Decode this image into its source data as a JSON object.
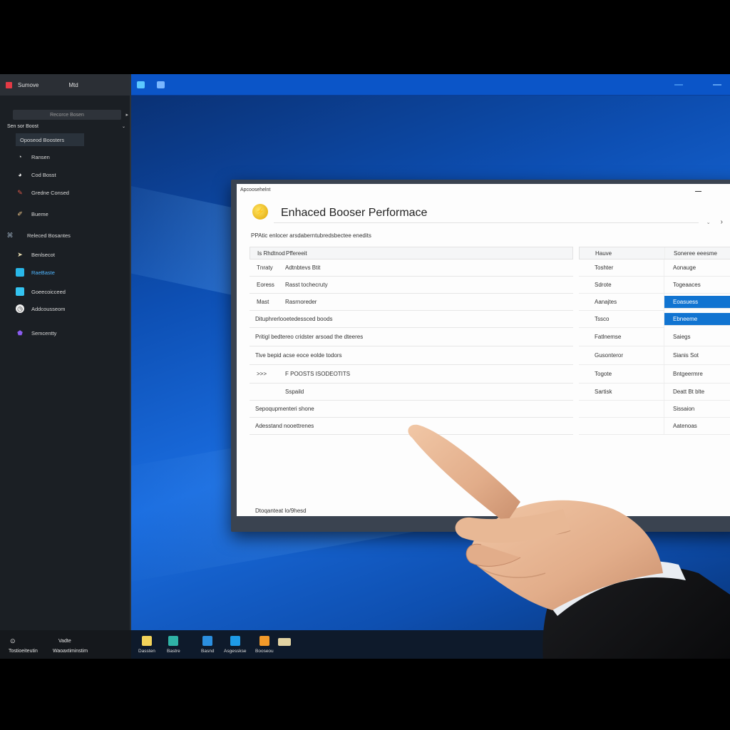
{
  "sidebar": {
    "header_left": "Sumove",
    "header_right": "Mtd",
    "search_placeholder": "Recorce Bosen",
    "group_label": "Sen sor Boost",
    "items": [
      {
        "label": "Oposeod Boosters",
        "icon": "selected-item"
      },
      {
        "label": "Ransen",
        "icon": "compass-icon"
      },
      {
        "label": "Cod Bosst",
        "icon": "speed-icon"
      },
      {
        "label": "Gredne Consed",
        "icon": "tools-icon"
      },
      {
        "label": "Bueme",
        "icon": "brush-icon"
      },
      {
        "label": "Releced Bosantes",
        "icon": "document-icon"
      },
      {
        "label": "Benlsecot",
        "icon": "tag-icon"
      },
      {
        "label": "RaeBaste",
        "icon": "image-icon"
      },
      {
        "label": "Goeecoicceed",
        "icon": "monitor-icon"
      },
      {
        "label": "Addcousseom",
        "icon": "gauge-icon"
      },
      {
        "label": "Semcentty",
        "icon": "shield-icon"
      }
    ],
    "footer": {
      "top_left": "⊙",
      "top_right": "Vadte",
      "bottom_left": "Tostioeiteutin",
      "bottom_right": "Waoaxtiminstim"
    }
  },
  "window": {
    "title_bar": "Apcoosehelnt",
    "app_title": "Enhaced Booser Performace",
    "subheading": "PPAtic enlocer  arsdaberntubredsbectee enedits",
    "left_table": {
      "header": [
        "Is Rhdtnod",
        "Pffereeit"
      ],
      "rows": [
        {
          "c1": "Tnraty",
          "c2": "Adtnbtevs Btit"
        },
        {
          "c1": "Eoress",
          "c2": "Rasst tochecruty"
        },
        {
          "c1": "Mast",
          "c2": "Rasrnoreder"
        },
        {
          "full": "Dituphrerlooetedessced boods"
        },
        {
          "full": "Pritigl bedtereo cridster arsoad the dteeres"
        },
        {
          "full": "Tive bepid acse eoce eolde todors"
        },
        {
          "c1": "&gt;&gt;&gt;",
          "c2": "F POOSTS ISODEOTITS"
        },
        {
          "c1": "",
          "c2": "Sspaild"
        },
        {
          "full": "Sepoqupmenteri shone"
        },
        {
          "full": "Adesstand nooettrenes"
        }
      ]
    },
    "right_table": {
      "header": [
        "Hauve",
        "Soneree eeesme"
      ],
      "rows": [
        {
          "a": "Toshter",
          "b": "Aonauge"
        },
        {
          "a": "Sdrote",
          "b": "Togeaaces"
        },
        {
          "a": "Aanajtes",
          "b": "Eoasuess",
          "b_selected": true
        },
        {
          "a": "Tssco",
          "b": "Ebneeme",
          "b_selected": true
        },
        {
          "a": "Fatlnemse",
          "b": "Saiegs"
        },
        {
          "a": "Gusonteror",
          "b": "Sianis Sot"
        },
        {
          "a": "Togote",
          "b": "Bntgeermre"
        },
        {
          "a": "Sartisk",
          "b": "Deatt Bt blte"
        },
        {
          "a": "",
          "b": "Sissaion"
        },
        {
          "a": "",
          "b": "Aatenoas"
        }
      ]
    },
    "footnote": "Dtoqanteat lo/9hesd"
  },
  "taskbar": {
    "items": [
      {
        "label": "Dassten",
        "color": "#f3d35a"
      },
      {
        "label": "Bastre",
        "color": "#2fb3a6"
      },
      {
        "label": "Basnd",
        "color": "#2b8fe0"
      },
      {
        "label": "Asgesskse",
        "color": "#1e9be8"
      },
      {
        "label": "Booseou",
        "color": "#f39a2a"
      },
      {
        "label": "",
        "color": "#e2d3a3"
      }
    ]
  },
  "colors": {
    "accent": "#1174d1",
    "sidebar_bg": "#1b1f24",
    "desktop_blue": "#0d4fb3"
  }
}
